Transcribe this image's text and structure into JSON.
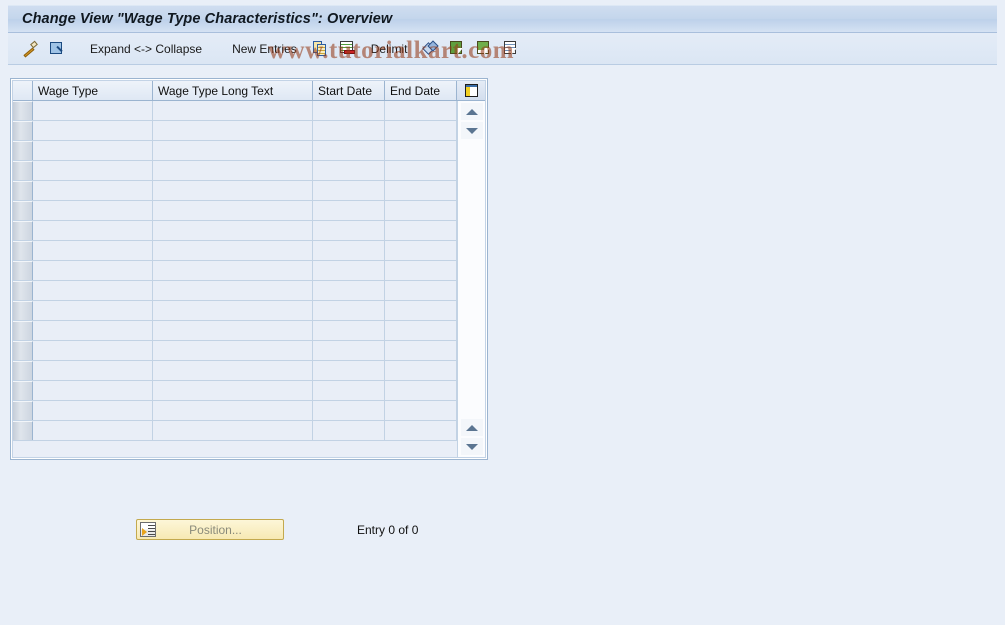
{
  "window": {
    "title": "Change View \"Wage Type Characteristics\": Overview"
  },
  "toolbar": {
    "items": [
      {
        "name": "display-change-toggle",
        "icon": "pencil-icon",
        "label": ""
      },
      {
        "name": "check-entries",
        "icon": "magnifier-icon",
        "label": ""
      },
      {
        "name": "expand-collapse",
        "icon": "",
        "label": "Expand <-> Collapse"
      },
      {
        "name": "new-entries",
        "icon": "",
        "label": "New Entries"
      },
      {
        "name": "copy-as",
        "icon": "doc-copy-icon",
        "label": ""
      },
      {
        "name": "delete-entry",
        "icon": "doc-delete-icon",
        "label": ""
      },
      {
        "name": "delimit",
        "icon": "delimit-icon",
        "label": "Delimit"
      },
      {
        "name": "undo-change",
        "icon": "undo-arrows-icon",
        "label": ""
      },
      {
        "name": "select-all",
        "icon": "doc-green-icon",
        "label": ""
      },
      {
        "name": "select-block",
        "icon": "doc-green-block-icon",
        "label": ""
      },
      {
        "name": "deselect-all",
        "icon": "doc-lines-icon",
        "label": ""
      }
    ],
    "expand_collapse_label": "Expand <-> Collapse",
    "new_entries_label": "New Entries",
    "delimit_label": "Delimit"
  },
  "watermark": {
    "text": "www.tutorialkart.com",
    "color": "#963c19"
  },
  "table": {
    "columns": [
      {
        "key": "selector",
        "label": ""
      },
      {
        "key": "wage_type",
        "label": "Wage Type"
      },
      {
        "key": "wage_type_long_text",
        "label": "Wage Type Long Text"
      },
      {
        "key": "start_date",
        "label": "Start Date"
      },
      {
        "key": "end_date",
        "label": "End Date"
      }
    ],
    "config_icon": "table-settings-icon",
    "rows": [],
    "empty_row_count": 17,
    "scroll": {
      "up_icon": "triangle-up-icon",
      "down_icon": "triangle-down-icon"
    }
  },
  "footer": {
    "position_button_label": "Position...",
    "position_button_icon": "position-icon",
    "entry_count_text": "Entry 0 of 0"
  },
  "colors": {
    "page_background": "#e9eff8",
    "title_bar": "#c4d6ec",
    "table_border": "#9bb4d0",
    "row_background": "#e9eef7",
    "button_yellow": "#f7e9b3"
  }
}
